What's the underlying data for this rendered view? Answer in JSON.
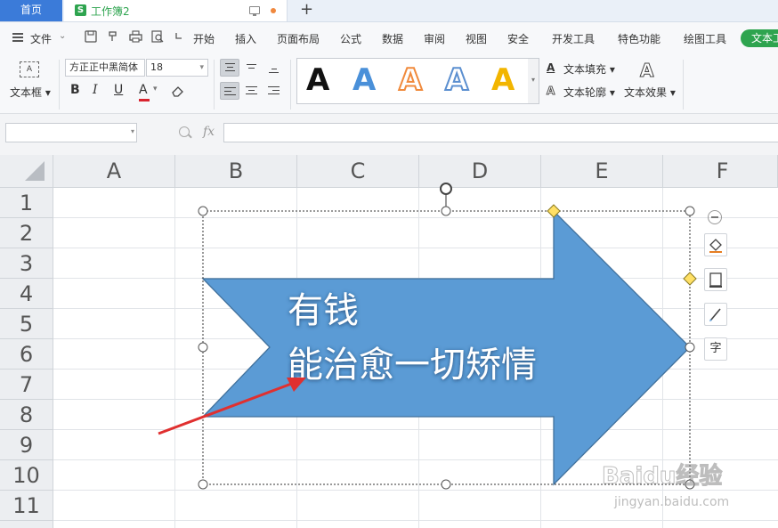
{
  "titlebar": {
    "home_tab": "首页",
    "doc_tab_name": "工作簿2",
    "doc_logo": "S",
    "new_tab": "+"
  },
  "menubar": {
    "file_label": "文件",
    "items": [
      "开始",
      "插入",
      "页面布局",
      "公式",
      "数据",
      "审阅",
      "视图",
      "安全",
      "开发工具",
      "特色功能",
      "绘图工具"
    ],
    "active_pill": "文本工具"
  },
  "ribbon": {
    "textbox_label": "文本框",
    "font_name": "方正正中黑简体",
    "font_size": "18",
    "bold": "B",
    "italic": "I",
    "underline": "U",
    "font_color": "A",
    "text_fill": "文本填充",
    "text_outline": "文本轮廓",
    "text_effects": "文本效果",
    "style_letters": [
      "A",
      "A",
      "A",
      "A",
      "A"
    ],
    "style_colors": [
      "#111111",
      "#4a90d9",
      "#f08a3c",
      "#5b8fd0",
      "#f2b500"
    ]
  },
  "formulabar": {
    "namebox_value": "",
    "fx_label": "fx",
    "formula_value": ""
  },
  "sheet": {
    "columns": [
      "A",
      "B",
      "C",
      "D",
      "E",
      "F"
    ],
    "rows": [
      "1",
      "2",
      "3",
      "4",
      "5",
      "6",
      "7",
      "8",
      "9",
      "10",
      "11"
    ]
  },
  "shape": {
    "line1": "有钱",
    "line2": "能治愈一切矫情",
    "fill_color": "#5b9bd5",
    "stroke_color": "#41719c",
    "annotation_color": "#e03030"
  },
  "float_tools": {
    "text_tool_glyph": "字"
  },
  "watermark": {
    "brand": "Baidu经验",
    "url": "jingyan.baidu.com"
  }
}
